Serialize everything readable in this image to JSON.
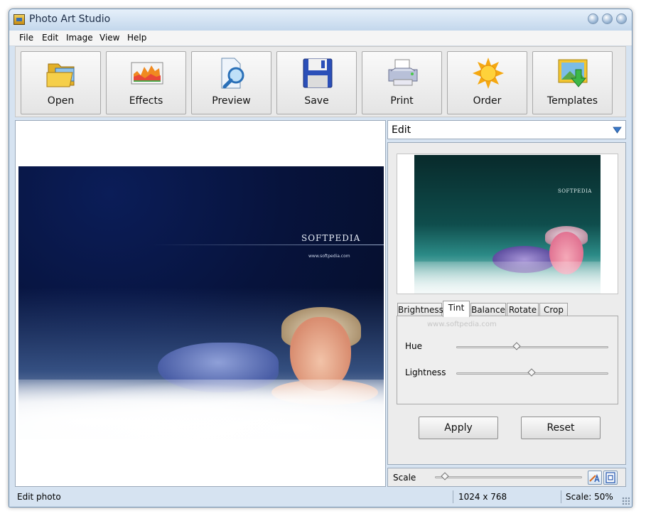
{
  "window": {
    "title": "Photo Art Studio"
  },
  "menu": [
    "File",
    "Edit",
    "Image",
    "View",
    "Help"
  ],
  "toolbar": [
    {
      "label": "Open",
      "icon": "open-folder-icon"
    },
    {
      "label": "Effects",
      "icon": "effects-chart-icon"
    },
    {
      "label": "Preview",
      "icon": "preview-magnifier-icon"
    },
    {
      "label": "Save",
      "icon": "save-floppy-icon"
    },
    {
      "label": "Print",
      "icon": "printer-icon"
    },
    {
      "label": "Order",
      "icon": "sun-icon"
    },
    {
      "label": "Templates",
      "icon": "templates-icon"
    }
  ],
  "photo": {
    "logo": "SOFTPEDIA",
    "url": "www.softpedia.com"
  },
  "panel": {
    "title": "Edit",
    "thumb_logo": "SOFTPEDIA",
    "watermark": "www.softpedia.com",
    "tabs": [
      "Brightness",
      "Tint",
      "Balance",
      "Rotate",
      "Crop"
    ],
    "active_tab": "Tint",
    "sliders": [
      {
        "label": "Hue",
        "value": 0.4
      },
      {
        "label": "Lightness",
        "value": 0.5
      }
    ],
    "apply_label": "Apply",
    "reset_label": "Reset"
  },
  "scale": {
    "label": "Scale",
    "value": 0.07
  },
  "status": {
    "message": "Edit photo",
    "dimensions": "1024 x 768",
    "scale": "Scale: 50%"
  },
  "colors": {
    "window_bg": "#d6e3f1",
    "toolbar_bg": "#e9e9e9",
    "accent": "#3a78c8"
  }
}
